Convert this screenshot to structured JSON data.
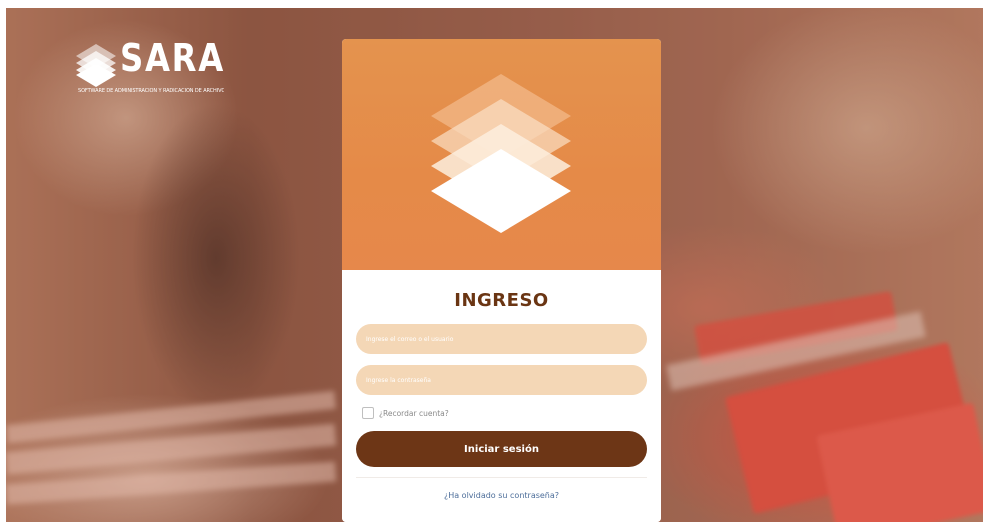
{
  "brand": {
    "name": "SARA",
    "tagline": "SOFTWARE DE ADMINISTRACIÓN Y RADICACIÓN DE ARCHIVO",
    "logo_icon": "layered-diamonds-icon"
  },
  "login": {
    "header_icon": "layered-diamonds-icon",
    "title": "INGRESO",
    "user_field": {
      "placeholder": "Ingrese el correo o el usuario",
      "value": ""
    },
    "password_field": {
      "placeholder": "Ingrese la contraseña",
      "value": ""
    },
    "remember_label": "¿Recordar cuenta?",
    "remember_checked": false,
    "submit_label": "Iniciar sesión",
    "forgot_label": "¿Ha olvidado su contraseña?"
  },
  "colors": {
    "header_orange": "#e58a48",
    "title_brown": "#6a3513",
    "field_bg": "#f4d7b6",
    "button_bg": "#6d3616",
    "link_blue": "#4d6e9a"
  }
}
